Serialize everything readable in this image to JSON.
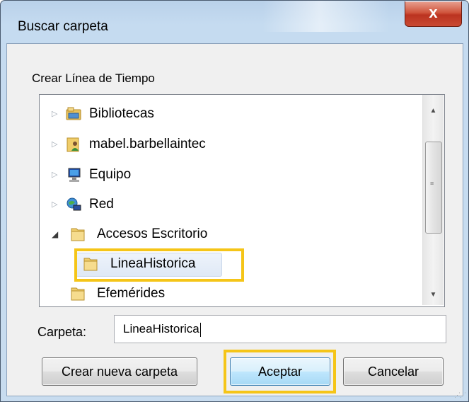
{
  "dialog": {
    "title": "Buscar carpeta",
    "close_label": "x",
    "description": "Crear Línea de Tiempo"
  },
  "tree": {
    "items": [
      {
        "label": "Bibliotecas",
        "icon": "libraries-icon",
        "expander": "collapsed"
      },
      {
        "label": "mabel.barbellaintec",
        "icon": "user-folder-icon",
        "expander": "collapsed"
      },
      {
        "label": "Equipo",
        "icon": "computer-icon",
        "expander": "collapsed"
      },
      {
        "label": "Red",
        "icon": "network-icon",
        "expander": "collapsed"
      },
      {
        "label": "Accesos Escritorio",
        "icon": "folder-icon",
        "expander": "expanded"
      },
      {
        "label": "LineaHistorica",
        "icon": "folder-icon",
        "expander": "none",
        "selected": true
      },
      {
        "label": "Efemérides",
        "icon": "folder-icon",
        "expander": "none"
      }
    ]
  },
  "folder_field": {
    "label": "Carpeta:",
    "value": "LineaHistorica"
  },
  "buttons": {
    "new_folder": "Crear nueva carpeta",
    "ok": "Aceptar",
    "cancel": "Cancelar"
  },
  "colors": {
    "highlight": "#f5c518",
    "close_button": "#c94a33",
    "title_bar": "#b9d1ea"
  }
}
